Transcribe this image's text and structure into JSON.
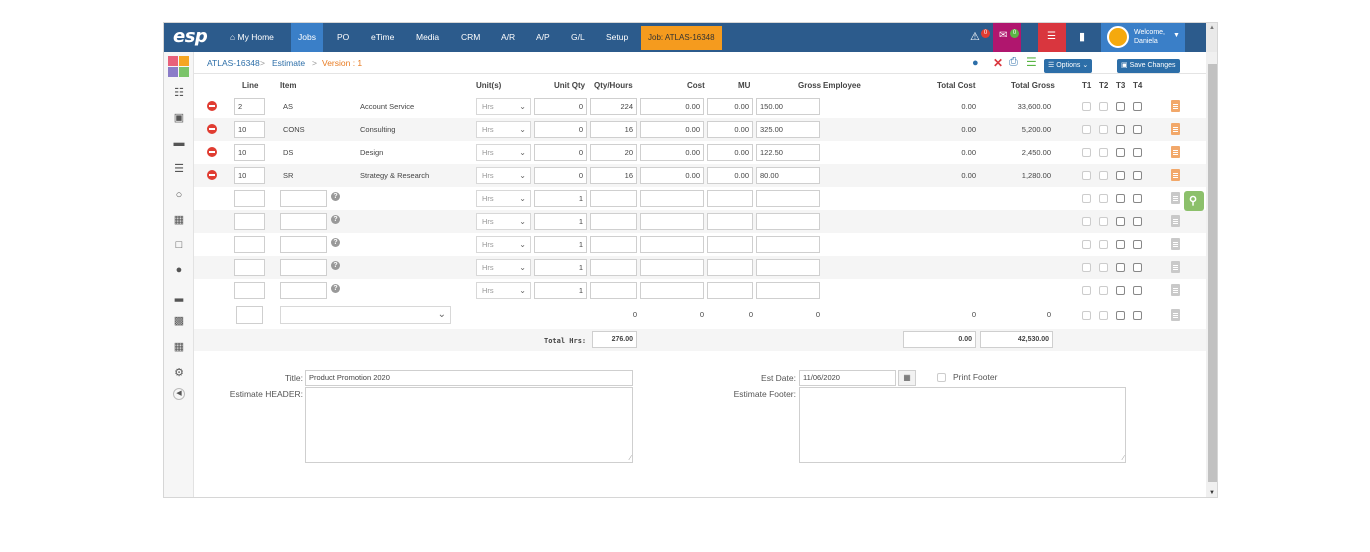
{
  "nav": {
    "logo": "esp",
    "items": [
      "My Home",
      "Jobs",
      "PO",
      "eTime",
      "Media",
      "CRM",
      "A/R",
      "A/P",
      "G/L",
      "Setup"
    ],
    "job": "Job: ATLAS-16348",
    "alerts_count": "0",
    "mail_count": "0",
    "welcome_line1": "Welcome,",
    "welcome_line2": "Daniela"
  },
  "breadcrumb": {
    "job": "ATLAS-16348",
    "sep": ">",
    "section": "Estimate",
    "version": "Version : 1"
  },
  "toolbar": {
    "options_label": "Options",
    "save_label": "Save Changes"
  },
  "table": {
    "headers": {
      "line": "Line",
      "item": "Item",
      "units": "Unit(s)",
      "unit_qty": "Unit Qty",
      "qty_hours": "Qty/Hours",
      "cost": "Cost",
      "mu": "MU",
      "gross": "Gross",
      "employee": "Employee",
      "total_cost": "Total Cost",
      "total_gross": "Total Gross",
      "t1": "T1",
      "t2": "T2",
      "t3": "T3",
      "t4": "T4"
    },
    "rows": [
      {
        "line": "2",
        "code": "AS",
        "desc": "Account Service",
        "unit": "Hrs",
        "unit_qty": "0",
        "qty": "224",
        "cost": "0.00",
        "mu": "0.00",
        "gross": "150.00",
        "total_cost": "0.00",
        "total_gross": "33,600.00"
      },
      {
        "line": "10",
        "code": "CONS",
        "desc": "Consulting",
        "unit": "Hrs",
        "unit_qty": "0",
        "qty": "16",
        "cost": "0.00",
        "mu": "0.00",
        "gross": "325.00",
        "total_cost": "0.00",
        "total_gross": "5,200.00"
      },
      {
        "line": "10",
        "code": "DS",
        "desc": "Design",
        "unit": "Hrs",
        "unit_qty": "0",
        "qty": "20",
        "cost": "0.00",
        "mu": "0.00",
        "gross": "122.50",
        "total_cost": "0.00",
        "total_gross": "2,450.00"
      },
      {
        "line": "10",
        "code": "SR",
        "desc": "Strategy & Research",
        "unit": "Hrs",
        "unit_qty": "0",
        "qty": "16",
        "cost": "0.00",
        "mu": "0.00",
        "gross": "80.00",
        "total_cost": "0.00",
        "total_gross": "1,280.00"
      }
    ],
    "empty_rows": [
      {
        "unit": "Hrs",
        "unit_qty": "1"
      },
      {
        "unit": "Hrs",
        "unit_qty": "1"
      },
      {
        "unit": "Hrs",
        "unit_qty": "1"
      },
      {
        "unit": "Hrs",
        "unit_qty": "1"
      },
      {
        "unit": "Hrs",
        "unit_qty": "1"
      }
    ],
    "sum_row": {
      "qty": "0",
      "cost": "0",
      "mu": "0",
      "gross": "0",
      "total_cost": "0",
      "total_gross": "0"
    },
    "totals": {
      "label": "Total Hrs:",
      "hours": "276.00",
      "total_cost": "0.00",
      "total_gross": "42,530.00"
    }
  },
  "form": {
    "title_label": "Title:",
    "title_value": "Product Promotion 2020",
    "header_label": "Estimate HEADER:",
    "est_date_label": "Est Date:",
    "est_date_value": "11/06/2020",
    "print_footer_label": "Print Footer",
    "footer_label": "Estimate Footer:"
  },
  "colors": {
    "nav_bg": "#2c5b8c",
    "nav_active": "#3a7fc8",
    "job_tab": "#f59b1e",
    "link": "#2c6ea8",
    "version": "#e87b21",
    "remove": "#e03c31"
  }
}
